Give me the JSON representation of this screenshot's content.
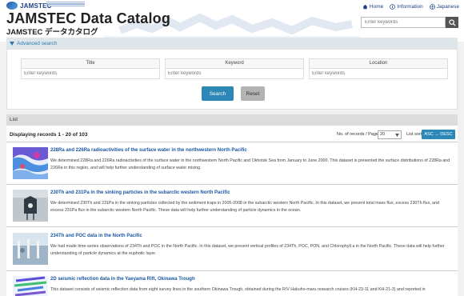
{
  "header": {
    "logo_text": "JAMSTEC",
    "title": "JAMSTEC Data Catalog",
    "subtitle": "JAMSTEC データカタログ",
    "nav": [
      {
        "label": "Home",
        "icon": "home-icon"
      },
      {
        "label": "Information",
        "icon": "info-icon"
      },
      {
        "label": "Japanese",
        "icon": "globe-icon"
      }
    ],
    "keyword_placeholder": "Enter keywords"
  },
  "advanced": {
    "toggle_label": "Advanced search",
    "fields": [
      {
        "label": "Title",
        "placeholder": "Enter keywords"
      },
      {
        "label": "Keyword",
        "placeholder": "Enter keywords"
      },
      {
        "label": "Location",
        "placeholder": "Enter keywords"
      }
    ],
    "search_label": "Search",
    "reset_label": "Reset"
  },
  "list": {
    "header": "List",
    "displaying": "Displaying records 1 - 20 of 103",
    "per_page_label": "No. of records / Page:",
    "per_page_value": "20",
    "sort_label": "List sort",
    "sort_value": "ASC → DESC",
    "records": [
      {
        "title": "228Ra and 226Ra radioactivities of the surface water in the northwestern North Pacific",
        "desc": "We determined 228Ra and 226Ra radioactivities of the surface water in the northwestern North Pacific and Okhotsk Sea from January to June 2000. This dataset is presented the surface distributions of 228Ra and 226Ra in this region, and will help further understanding of surface water mixing."
      },
      {
        "title": "230Th and 231Pa in the sinking particles in the subarctic western North Pacific",
        "desc": "We determined 230Th and 231Pa in the sinking particles collected by the sediment traps in 2005-2008 in the subarctic western North Pacific. In this dataset, we present total mass flux, excess 230Th flux, and excess 231Pa flux in the subarctic western North Pacific. These data will help further understanding of particle dynamics in the ocean."
      },
      {
        "title": "234Th and POC data in the North Pacific",
        "desc": "We had made time-series observations of 234Th and POC in the North Pacific. In this dataset, we present vertical profiles of 234Th, POC, PON, and Chlorophyll a in the North Pacific. These data will help further understanding of particle dynamics at the euphotic layer."
      },
      {
        "title": "2D seismic reflection data in the Yaeyama Rift, Okinawa Trough",
        "desc": "This dataset consists of seismic reflection data from eight survey lines in the southern Okinawa Trough, obtained during the R/V Hakuho-maru research cruises (KH-23-11 and KH-21-3) and reported in"
      }
    ]
  }
}
